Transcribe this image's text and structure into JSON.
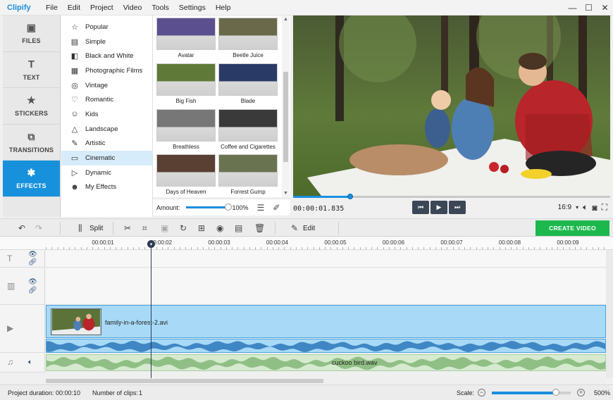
{
  "app": {
    "logo": "Clipify"
  },
  "menu": [
    "File",
    "Edit",
    "Project",
    "Video",
    "Tools",
    "Settings",
    "Help"
  ],
  "window_controls": {
    "minimize": "—",
    "maximize": "☐",
    "close": "✕"
  },
  "side_tabs": [
    {
      "label": "FILES",
      "icon": "image-icon",
      "glyph": "▣",
      "active": false
    },
    {
      "label": "TEXT",
      "icon": "text-icon",
      "glyph": "T",
      "active": false
    },
    {
      "label": "STICKERS",
      "icon": "star-icon",
      "glyph": "★",
      "active": false
    },
    {
      "label": "TRANSITIONS",
      "icon": "transitions-icon",
      "glyph": "⧉",
      "active": false
    },
    {
      "label": "EFFECTS",
      "icon": "effects-icon",
      "glyph": "✱",
      "active": true
    }
  ],
  "categories": [
    {
      "label": "Popular",
      "glyph": "☆"
    },
    {
      "label": "Simple",
      "glyph": "▤"
    },
    {
      "label": "Black and White",
      "glyph": "◧"
    },
    {
      "label": "Photographic Films",
      "glyph": "▦"
    },
    {
      "label": "Vintage",
      "glyph": "◎"
    },
    {
      "label": "Romantic",
      "glyph": "♡"
    },
    {
      "label": "Kids",
      "glyph": "☺"
    },
    {
      "label": "Landscape",
      "glyph": "△"
    },
    {
      "label": "Artistic",
      "glyph": "✎"
    },
    {
      "label": "Cinematic",
      "glyph": "▭",
      "selected": true
    },
    {
      "label": "Dynamic",
      "glyph": "▷"
    },
    {
      "label": "My Effects",
      "glyph": "☻"
    }
  ],
  "effects": [
    {
      "label": "Avatar",
      "tint": "#5b4f8f"
    },
    {
      "label": "Beetle Juice",
      "tint": "#6a6a4a"
    },
    {
      "label": "Big Fish",
      "tint": "#5f7a38"
    },
    {
      "label": "Blade",
      "tint": "#2a3a66"
    },
    {
      "label": "Breathless",
      "tint": "#777777"
    },
    {
      "label": "Coffee and Cigarettes",
      "tint": "#3a3a3a"
    },
    {
      "label": "Days of Heaven",
      "tint": "#5a3f33"
    },
    {
      "label": "Forrest Gump",
      "tint": "#6a7350"
    }
  ],
  "amount": {
    "label": "Amount:",
    "value": "100%",
    "level": 1.0
  },
  "player": {
    "timecode": "00:00:01.835",
    "aspect": "16:9",
    "progress": 0.18,
    "buttons": {
      "prev": "⏮",
      "play": "▶",
      "next": "⏭"
    }
  },
  "toolbar": {
    "split": "Split",
    "edit": "Edit",
    "create": "CREATE VIDEO"
  },
  "ruler": [
    "00:00:01",
    "00:00:02",
    "00:00:03",
    "00:00:04",
    "00:00:05",
    "00:00:06",
    "00:00:07",
    "00:00:08",
    "00:00:09"
  ],
  "timeline": {
    "video_clip": "family-in-a-forest-2.avi",
    "audio_clip": "cuckoo bird.wav"
  },
  "status": {
    "duration_label": "Project duration:",
    "duration": "00:00:10",
    "clips_label": "Number of clips:",
    "clips": "1",
    "scale_label": "Scale:",
    "scale_value": "500%"
  },
  "colors": {
    "accent": "#1891dc",
    "create": "#1cb84e"
  }
}
